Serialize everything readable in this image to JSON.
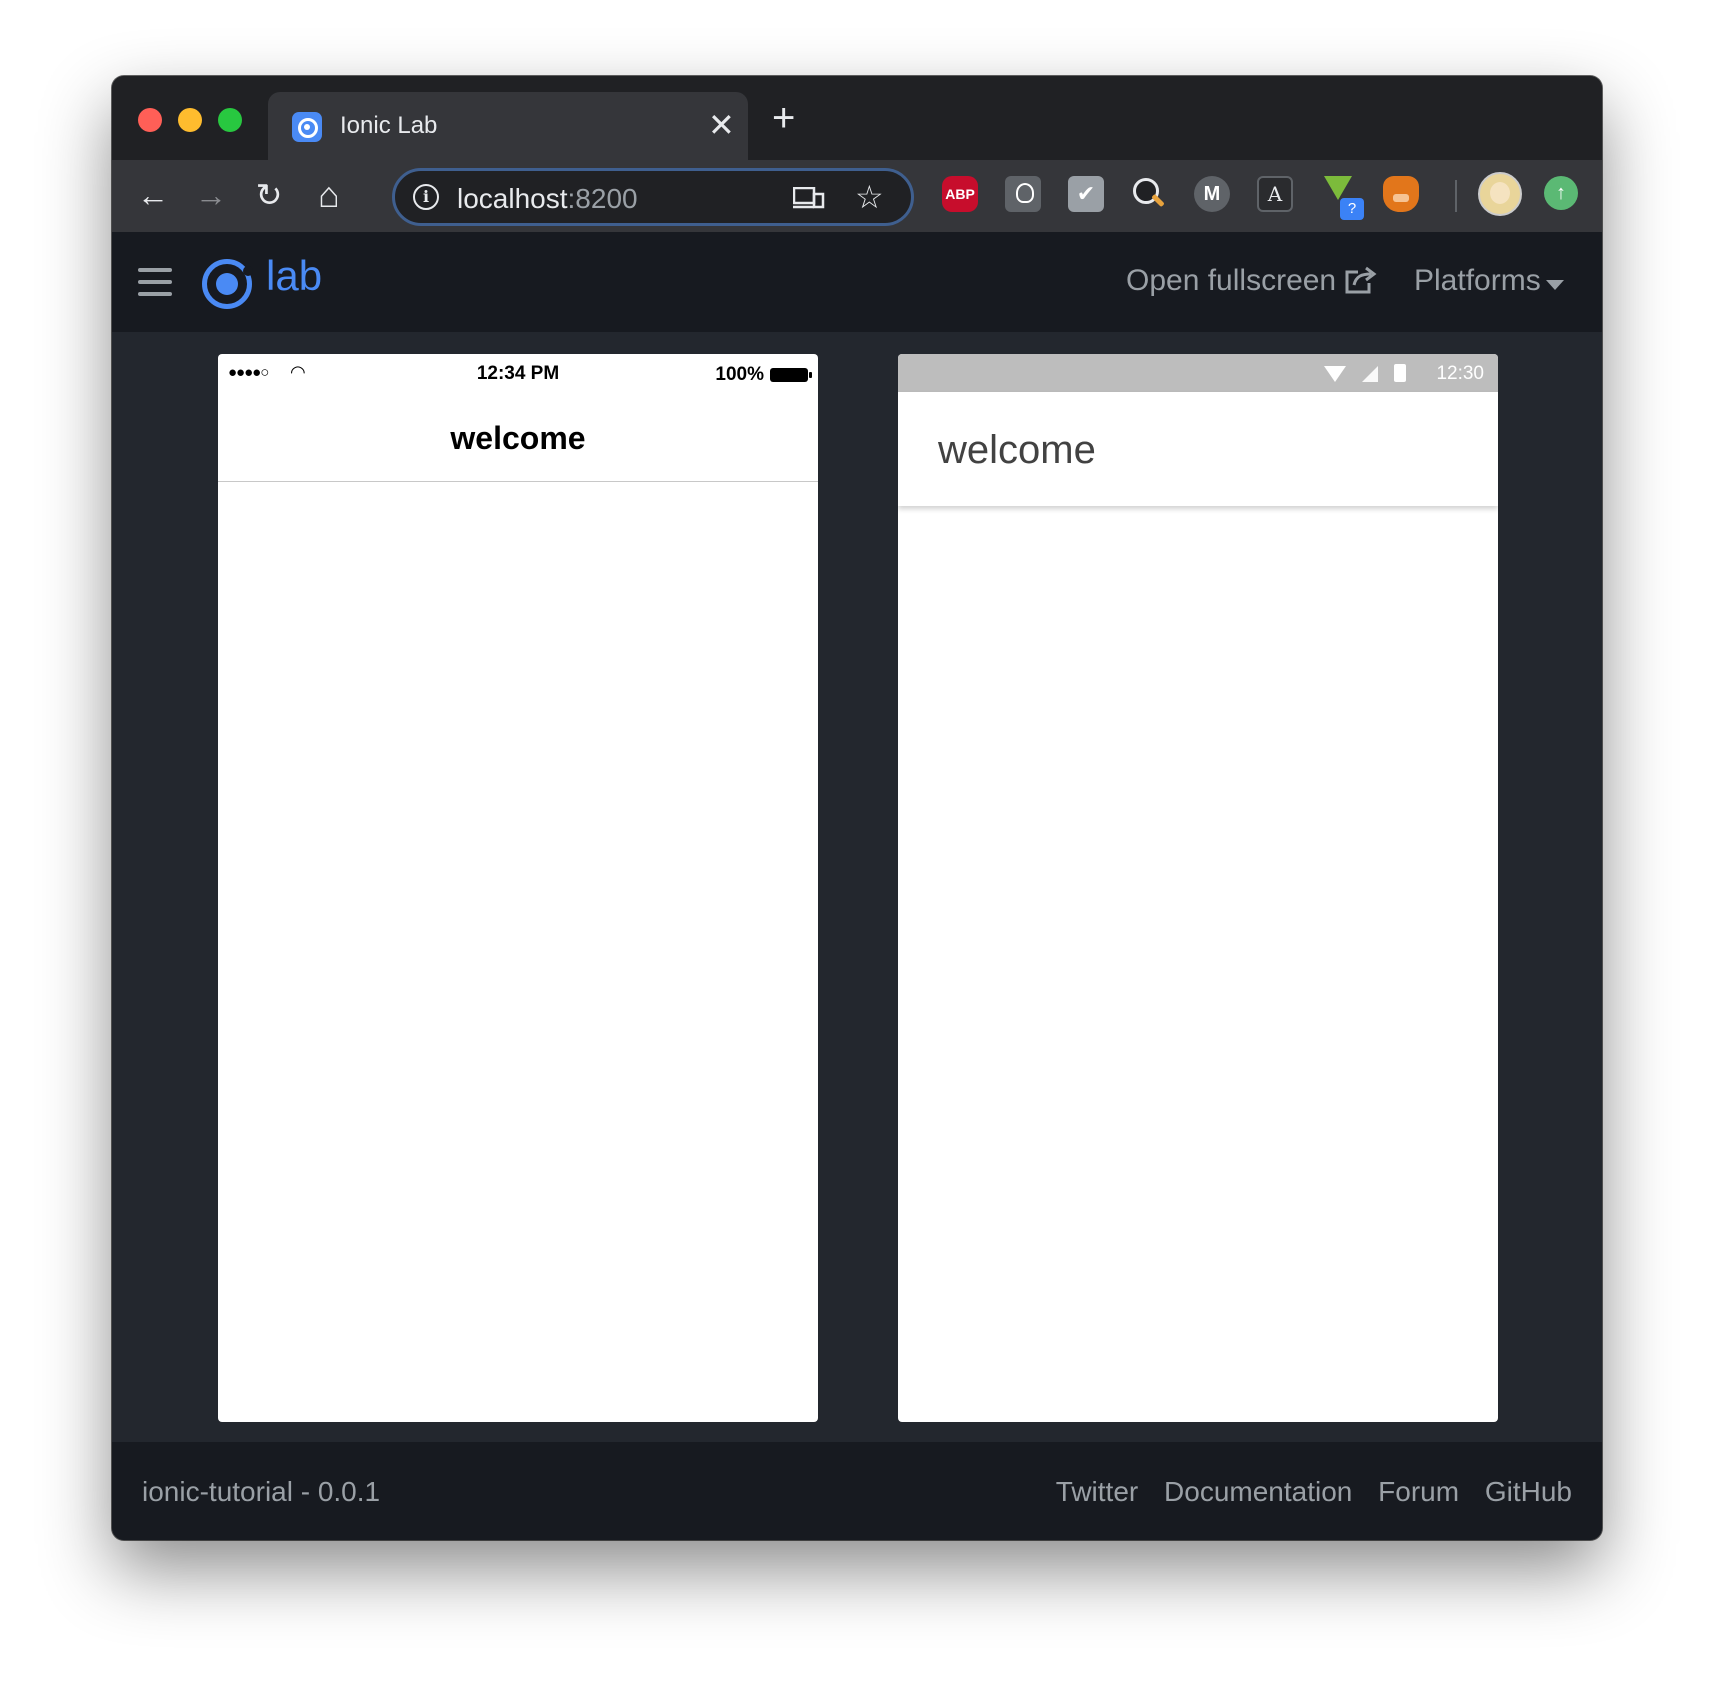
{
  "browser": {
    "tab": {
      "title": "Ionic Lab",
      "close_glyph": "✕"
    },
    "new_tab_glyph": "+",
    "toolbar": {
      "back_glyph": "←",
      "forward_glyph": "→",
      "reload_glyph": "↻",
      "home_glyph": "⌂",
      "url_host": "localhost",
      "url_port": ":8200",
      "star_glyph": "☆"
    },
    "extensions": {
      "abp_label": "ABP",
      "check_glyph": "✔",
      "m_label": "M",
      "a_label": "A",
      "badge_label": "?",
      "update_glyph": "↑"
    }
  },
  "lab": {
    "logo_text": "lab",
    "open_fullscreen": "Open fullscreen",
    "platforms": "Platforms"
  },
  "ios_device": {
    "signal": "●●●●○",
    "wifi_glyph": "◠",
    "time": "12:34 PM",
    "battery_pct": "100%",
    "title": "welcome"
  },
  "md_device": {
    "time": "12:30",
    "title": "welcome"
  },
  "footer": {
    "app_version": "ionic-tutorial - 0.0.1",
    "links": [
      "Twitter",
      "Documentation",
      "Forum",
      "GitHub"
    ]
  },
  "colors": {
    "ionic_blue": "#4a8af4",
    "lab_bg": "#23272e",
    "lab_header_bg": "#171a20",
    "md_statusbar": "#bdbdbd"
  }
}
